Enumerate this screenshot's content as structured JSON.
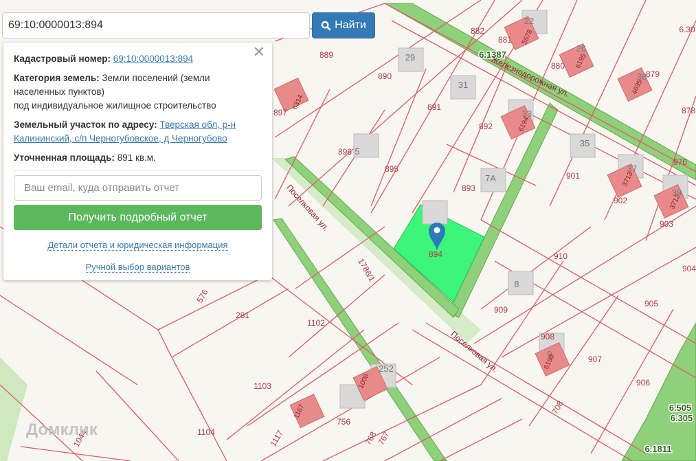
{
  "search": {
    "value": "69:10:0000013:894",
    "button": "Найти",
    "icon": "search-icon"
  },
  "panel": {
    "cad_label": "Кадастровый номер:",
    "cad_value": "69:10:0000013:894",
    "cat_label": "Категория земель:",
    "cat_value1": "Земли поселений (земли",
    "cat_value2": "населенных пунктов)",
    "cat_value3": "под индивидуальное жилищное строительство",
    "addr_label": "Земельный участок по адресу:",
    "addr_value1": "Тверская обл, р-н",
    "addr_value2": "Калининский, с/п Черногубовское, д Черногубово",
    "area_label": "Уточненная площадь:",
    "area_value": "891 кв.м.",
    "email_placeholder": "Ваш email, куда отправить отчет",
    "report_button": "Получить подробный отчет",
    "details_link": "Детали отчета и юридическая информация",
    "manual_link": "Ручной выбор вариантов"
  },
  "map": {
    "parcel_labels": [
      "882",
      "881",
      "880",
      "879",
      "878",
      "889",
      "890",
      "891",
      "892",
      "897",
      "896",
      "895",
      "893",
      "901",
      "902",
      "903",
      "970",
      "894",
      "910",
      "904",
      "909",
      "905",
      "908",
      "907",
      "906",
      "281",
      "1102",
      "1103",
      "576",
      "1786/1",
      "756",
      "768",
      "767",
      "1117",
      "1044",
      "1104",
      "708",
      "6.30"
    ],
    "building_labels": [
      "22",
      "26",
      "38",
      "29",
      "31",
      "33",
      "5",
      "7A",
      "35",
      "37",
      "39",
      "8",
      "9",
      "252"
    ],
    "building_cad": [
      "5578",
      "6195",
      "4635",
      "6194",
      "6314",
      "3713",
      "3712",
      "6190",
      "1008",
      "1167"
    ],
    "zone_labels": [
      "6.1387",
      "6.505",
      "6.305",
      "6.1811"
    ],
    "streets": [
      "Поселковая ул.",
      "Поселковая ул.",
      "Железнодорожная ул."
    ],
    "watermark": "Домклик",
    "colors": {
      "parcel": "#e05a6a",
      "selected": "#3cf57a",
      "zone": "#7cc86a"
    }
  }
}
